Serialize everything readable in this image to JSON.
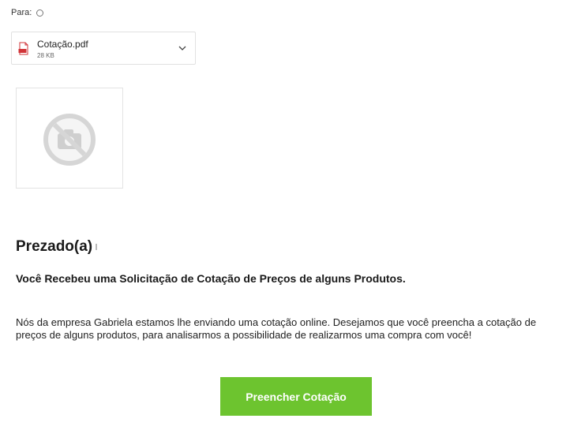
{
  "header": {
    "to_label": "Para:"
  },
  "attachment": {
    "filename": "Cotação.pdf",
    "size": "28 KB",
    "icon": "pdf-file-icon"
  },
  "image": {
    "icon": "broken-image-icon"
  },
  "email": {
    "greeting": "Prezado(a)",
    "subheading": "Você Recebeu uma Solicitação de Cotação de Preços de alguns Produtos.",
    "body": "Nós da empresa Gabriela estamos lhe enviando uma cotação online. Desejamos que você preencha a cotação de preços de alguns produtos, para analisarmos a possibilidade de realizarmos uma compra com você!",
    "button_label": "Preencher Cotação",
    "button_color": "#6dc42f"
  }
}
